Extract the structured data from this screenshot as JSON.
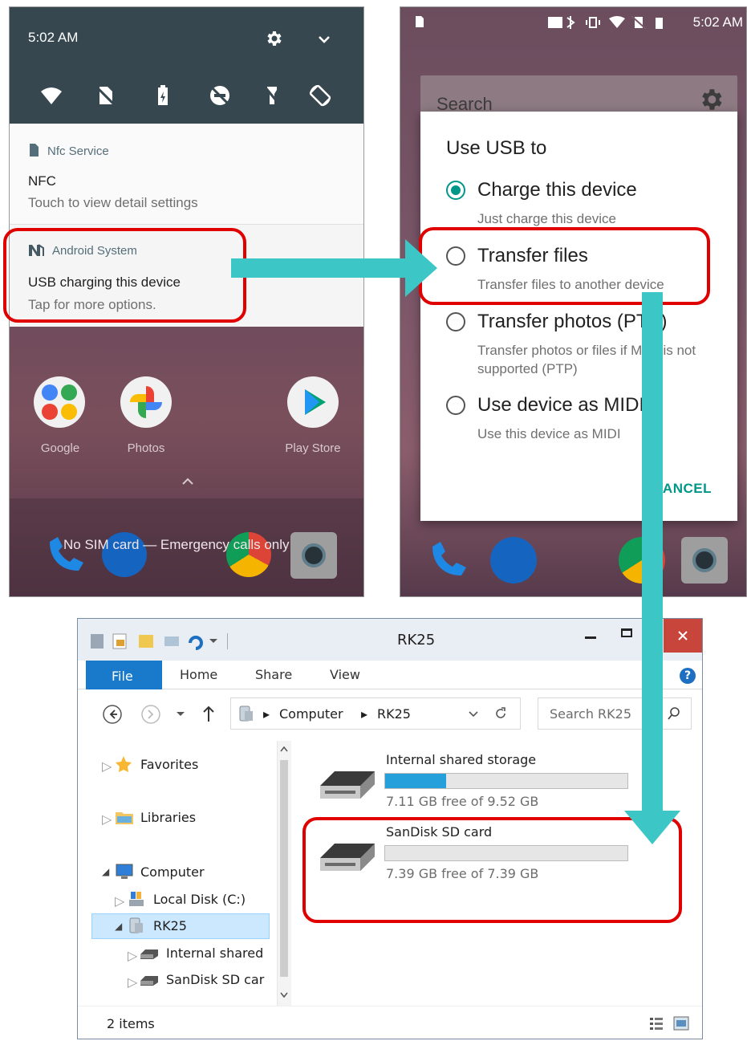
{
  "phone1": {
    "time": "5:02 AM",
    "notifications": [
      {
        "app": "Nfc Service",
        "title": "NFC",
        "subtitle": "Touch to view detail settings"
      },
      {
        "app": "Android System",
        "title": "USB charging this device",
        "subtitle": "Tap for more options."
      }
    ],
    "home_apps": [
      "Google",
      "Photos",
      "Play Store"
    ],
    "sim_status": "No SIM card — Emergency calls only"
  },
  "phone2": {
    "time": "5:02 AM",
    "search_placeholder": "Search",
    "dialog": {
      "title": "Use USB to",
      "options": [
        {
          "label": "Charge this device",
          "subtitle": "Just charge this device",
          "selected": true
        },
        {
          "label": "Transfer files",
          "subtitle": "Transfer files to another device",
          "selected": false
        },
        {
          "label": "Transfer photos (PTP)",
          "subtitle": "Transfer photos or files if MTP is not supported (PTP)",
          "selected": false
        },
        {
          "label": "Use device as MIDI",
          "subtitle": "Use this device as MIDI",
          "selected": false
        }
      ],
      "cancel": "CANCEL"
    }
  },
  "explorer": {
    "title": "RK25",
    "tabs": {
      "file": "File",
      "home": "Home",
      "share": "Share",
      "view": "View"
    },
    "help": "?",
    "breadcrumb": [
      "Computer",
      "RK25"
    ],
    "search_placeholder": "Search RK25",
    "nav": {
      "favorites": "Favorites",
      "libraries": "Libraries",
      "computer": "Computer",
      "local_disk": "Local Disk (C:)",
      "rk25": "RK25",
      "internal": "Internal shared",
      "sdcard": "SanDisk SD car"
    },
    "drives": [
      {
        "name": "Internal shared storage",
        "free": "7.11 GB free of 9.52 GB",
        "used_fraction": 0.25
      },
      {
        "name": "SanDisk SD card",
        "free": "7.39 GB free of 7.39 GB",
        "used_fraction": 0.0
      }
    ],
    "status": "2 items"
  },
  "colors": {
    "highlight": "#e00000",
    "arrow": "#3cc6c6",
    "accent": "#009688",
    "explorer_blue": "#1979ca"
  }
}
